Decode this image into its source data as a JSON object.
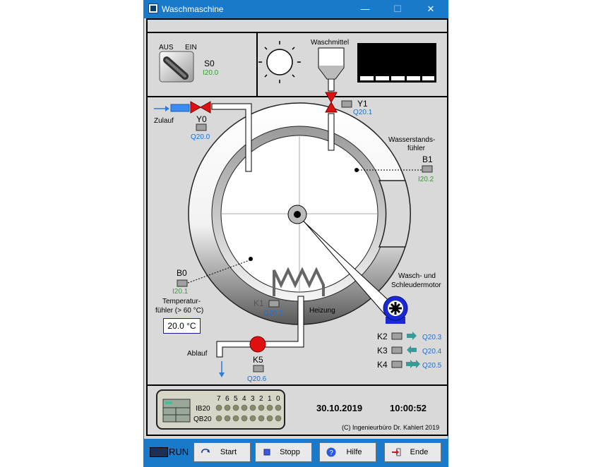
{
  "window": {
    "title": "Waschmaschine",
    "minimize": "—",
    "maximize": "☐",
    "close": "✕"
  },
  "switch": {
    "off": "AUS",
    "on": "EIN",
    "name": "S0",
    "addr": "I20.0"
  },
  "detergent": {
    "label": "Waschmittel"
  },
  "valve_y1": {
    "name": "Y1",
    "addr": "Q20.1"
  },
  "valve_y0": {
    "name": "Y0",
    "addr": "Q20.0"
  },
  "inlet": {
    "label": "Zulauf"
  },
  "level_sensor": {
    "label_1": "Wasserstands-",
    "label_2": "fühler",
    "name": "B1",
    "addr": "I20.2"
  },
  "temp_sensor": {
    "name": "B0",
    "addr": "I20.1",
    "label_1": "Temperatur-",
    "label_2": "fühler (> 60 °C)",
    "value": "20.0 °C"
  },
  "heater": {
    "name": "K1",
    "addr": "Q20.2",
    "label": "Heizung"
  },
  "motor": {
    "label_1": "Wasch- und",
    "label_2": "Schleudermotor"
  },
  "contactors": [
    {
      "name": "K2",
      "addr": "Q20.3"
    },
    {
      "name": "K3",
      "addr": "Q20.4"
    },
    {
      "name": "K4",
      "addr": "Q20.5"
    }
  ],
  "drain": {
    "label": "Ablauf",
    "name": "K5",
    "addr": "Q20.6"
  },
  "plc": {
    "bits": [
      "7",
      "6",
      "5",
      "4",
      "3",
      "2",
      "1",
      "0"
    ],
    "input_row": "IB20",
    "output_row": "QB20"
  },
  "status": {
    "date": "30.10.2019",
    "time": "10:00:52",
    "copyright": "(C) Ingenieurbüro Dr. Kahlert 2019"
  },
  "buttons": {
    "run": "RUN",
    "start": "Start",
    "stop": "Stopp",
    "help": "Hilfe",
    "end": "Ende"
  },
  "colors": {
    "accent": "#1979ca",
    "address_green": "#2da12d",
    "address_blue": "#1f6fd1",
    "valve_red": "#e01010"
  }
}
